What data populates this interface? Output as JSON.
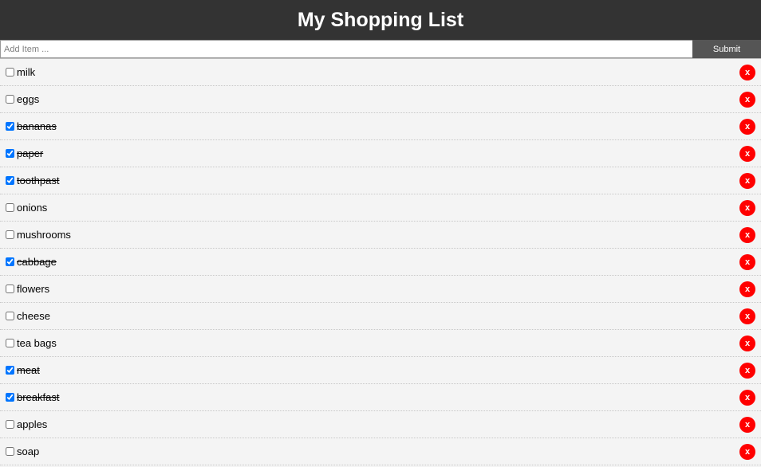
{
  "header": {
    "title": "My Shopping List"
  },
  "add_form": {
    "placeholder": "Add Item ...",
    "value": "",
    "submit_label": "Submit"
  },
  "items": [
    {
      "label": "milk",
      "checked": false,
      "delete_label": "x"
    },
    {
      "label": "eggs",
      "checked": false,
      "delete_label": "x"
    },
    {
      "label": "bananas",
      "checked": true,
      "delete_label": "x"
    },
    {
      "label": "paper",
      "checked": true,
      "delete_label": "x"
    },
    {
      "label": "toothpast",
      "checked": true,
      "delete_label": "x"
    },
    {
      "label": "onions",
      "checked": false,
      "delete_label": "x"
    },
    {
      "label": "mushrooms",
      "checked": false,
      "delete_label": "x"
    },
    {
      "label": "cabbage",
      "checked": true,
      "delete_label": "x"
    },
    {
      "label": "flowers",
      "checked": false,
      "delete_label": "x"
    },
    {
      "label": "cheese",
      "checked": false,
      "delete_label": "x"
    },
    {
      "label": "tea bags",
      "checked": false,
      "delete_label": "x"
    },
    {
      "label": "meat",
      "checked": true,
      "delete_label": "x"
    },
    {
      "label": "breakfast",
      "checked": true,
      "delete_label": "x"
    },
    {
      "label": "apples",
      "checked": false,
      "delete_label": "x"
    },
    {
      "label": "soap",
      "checked": false,
      "delete_label": "x"
    }
  ],
  "colors": {
    "header_bg": "#333333",
    "submit_bg": "#555555",
    "delete_bg": "#ff0000",
    "list_bg": "#f4f4f4"
  }
}
